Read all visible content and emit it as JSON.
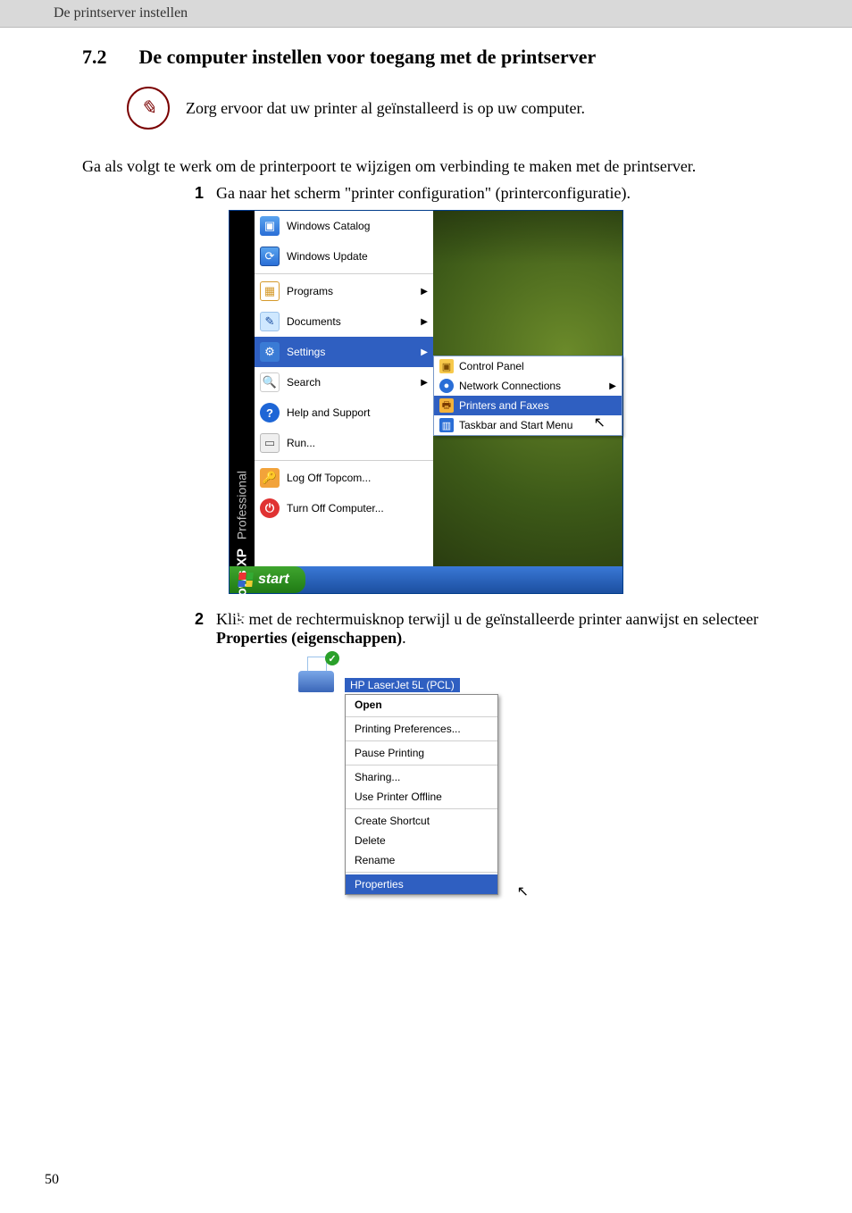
{
  "header": "De printserver instellen",
  "section": {
    "number": "7.2",
    "title": "De computer instellen voor toegang met de printserver"
  },
  "note_text": "Zorg ervoor dat uw printer al geïnstalleerd is op uw computer.",
  "intro_text": "Ga als volgt te werk om de printerpoort te wijzigen om verbinding te maken met de printserver.",
  "steps": {
    "s1": {
      "num": "1",
      "text": "Ga naar het scherm \"printer configuration\" (printerconfiguratie)."
    },
    "s2": {
      "num": "2",
      "text_a": "Klik met de rechtermuisknop terwijl u de geïnstalleerde printer aanwijst en selecteer ",
      "bold": "Properties (eigenschappen)",
      "text_b": "."
    }
  },
  "start_menu": {
    "brand_prof": "Professional",
    "brand_win": "Windows XP",
    "items": {
      "catalog": "Windows Catalog",
      "update": "Windows Update",
      "programs": "Programs",
      "documents": "Documents",
      "settings": "Settings",
      "search": "Search",
      "help": "Help and Support",
      "run": "Run...",
      "logoff": "Log Off Topcom...",
      "turnoff": "Turn Off Computer..."
    },
    "sub": {
      "control_panel": "Control Panel",
      "network_conn": "Network Connections",
      "printers_faxes": "Printers and Faxes",
      "taskbar": "Taskbar and Start Menu"
    },
    "start_label": "start"
  },
  "context_menu": {
    "printer_name": "HP LaserJet 5L (PCL)",
    "items": {
      "open": "Open",
      "prefs": "Printing Preferences...",
      "pause": "Pause Printing",
      "sharing": "Sharing...",
      "offline": "Use Printer Offline",
      "shortcut": "Create Shortcut",
      "delete": "Delete",
      "rename": "Rename",
      "properties": "Properties"
    }
  },
  "page_number": "50"
}
